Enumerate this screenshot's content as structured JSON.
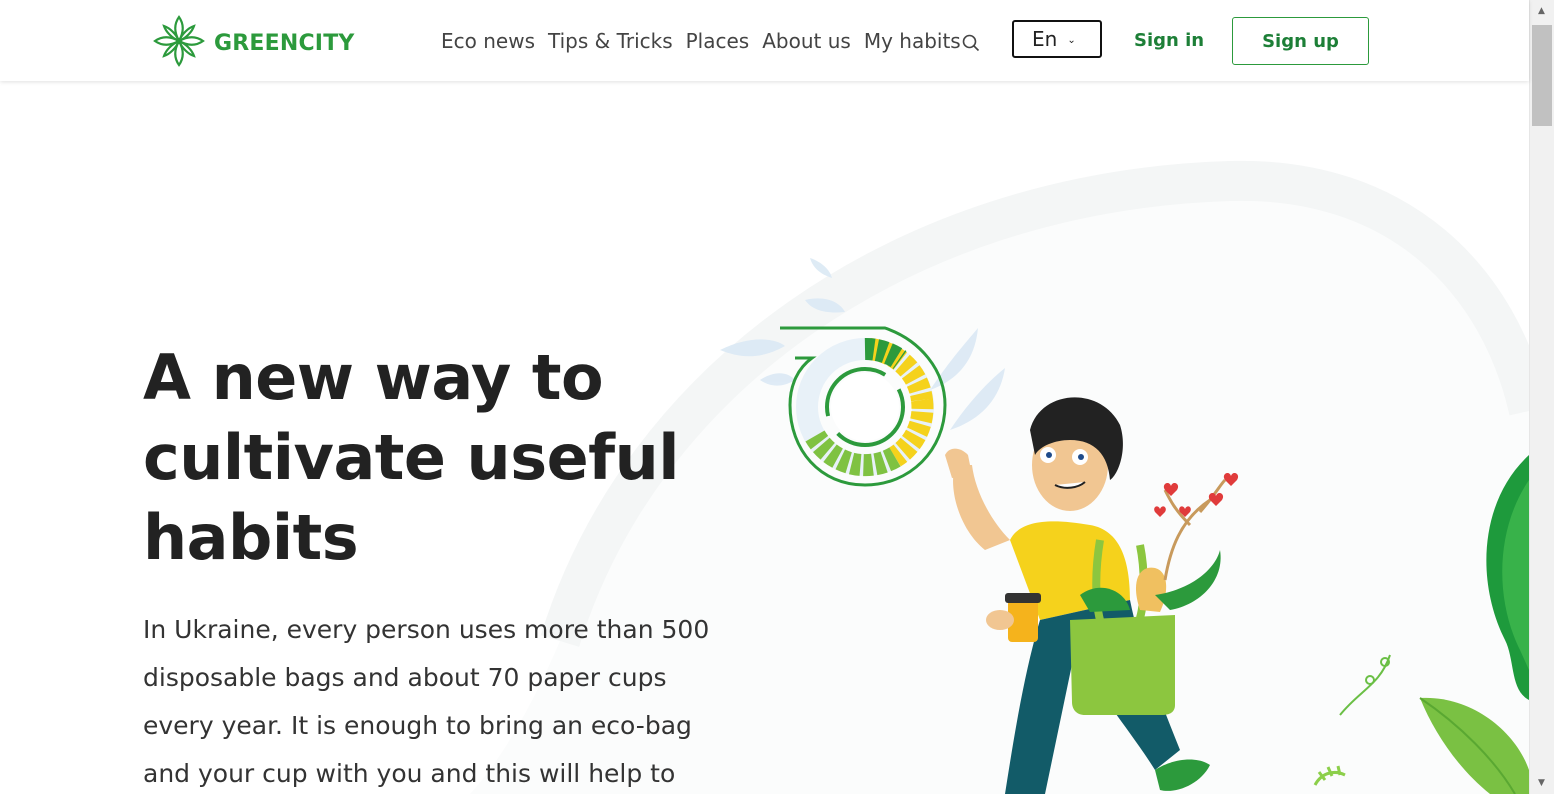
{
  "header": {
    "logo_text": "GREENCITY",
    "nav": [
      {
        "label": "Eco news"
      },
      {
        "label": "Tips & Tricks"
      },
      {
        "label": "Places"
      },
      {
        "label": "About us"
      },
      {
        "label": "My habits"
      }
    ],
    "search_icon": "search-icon",
    "language": {
      "selected": "En",
      "chevron": "chevron-down-icon"
    },
    "sign_in": "Sign in",
    "sign_up": "Sign up"
  },
  "hero": {
    "title": "A new way to cultivate useful habits",
    "text": "In Ukraine, every person uses more than 500 disposable bags and about 70 paper cups every year. It is enough to bring an eco-bag and your cup with you and this will help to"
  },
  "colors": {
    "brand_green": "#2c9a3c",
    "dark_green": "#1d7f37",
    "yellow": "#f5d21c",
    "text_dark": "#222222"
  }
}
